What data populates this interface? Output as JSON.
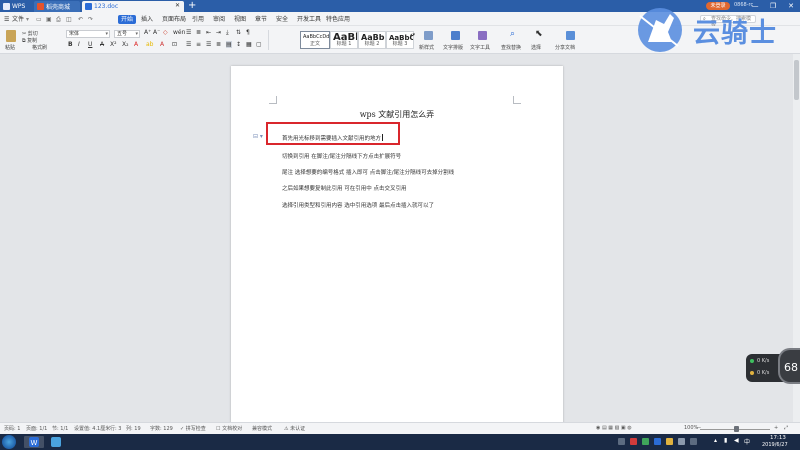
{
  "tabs": [
    {
      "label": "WPS",
      "icon": "wps-icon"
    },
    {
      "label": "稻壳商城",
      "icon": "docer-icon"
    },
    {
      "label": "123.doc",
      "icon": "word-doc-icon"
    }
  ],
  "add_tab": "+",
  "account": {
    "login": "未登录",
    "user": "0868-rc"
  },
  "window_controls": [
    "—",
    "❐",
    "✕"
  ],
  "menu": {
    "file": "文件",
    "items": [
      "开始",
      "插入",
      "页面布局",
      "引用",
      "审阅",
      "视图",
      "章节",
      "安全",
      "开发工具",
      "特色应用"
    ],
    "active_index": 0,
    "search_placeholder": "查找命令、搜索模板"
  },
  "ribbon": {
    "paste": "粘贴",
    "cut": "剪切",
    "copy": "复制",
    "format_painter": "格式刷",
    "font_name": "宋体",
    "font_size": "五号",
    "styles": [
      {
        "preview": "AaBbCcDd",
        "name": "正文"
      },
      {
        "preview": "AaBb",
        "name": "标题 1"
      },
      {
        "preview": "AaBb(",
        "name": "标题 2"
      },
      {
        "preview": "AaBbC(",
        "name": "标题 3"
      }
    ],
    "new_style": "新样式",
    "text_layout": "文字排版",
    "text_tools": "文字工具",
    "find_replace": "查找替换",
    "select": "选择",
    "share_doc": "分享文档"
  },
  "document": {
    "title": "wps 文献引用怎么弄",
    "lines": [
      "首先用光标移到需要插入文献引用的地方",
      "切换到引用 在脚注/尾注分隔线下方点击扩展符号",
      "尾注 选择想要的编号格式 插入即可 点击脚注/尾注分隔线可去掉分割线",
      "之后如果想要复制此引用 可在引用中 点击交叉引用",
      "选择引用类型和引用内容 选中引用选项 最后点击插入就可以了"
    ],
    "paragraph_mark": "⊟ ▾"
  },
  "watermark": {
    "text": "云骑士"
  },
  "speed_widget": {
    "up": "0 K/s",
    "down": "0 K/s",
    "percent": "68"
  },
  "status": {
    "page_num": "页码: 1",
    "pages": "页面: 1/1",
    "section": "节: 1/1",
    "set_value": "设置值: 4.1厘米",
    "row": "行: 3",
    "col": "列: 19",
    "words": "字数: 129",
    "spell": "拼写检查",
    "doc_proof": "文档校对",
    "compat": "兼容模式",
    "unauth": "未认证",
    "zoom": "100%",
    "zoom_minus": "—",
    "zoom_plus": "+"
  },
  "taskbar": {
    "time": "17:13",
    "date": "2019/6/27"
  },
  "colors": {
    "accent": "#2b6cd6",
    "titlebar": "#2b5ea8",
    "highlight": "#d9262c"
  }
}
